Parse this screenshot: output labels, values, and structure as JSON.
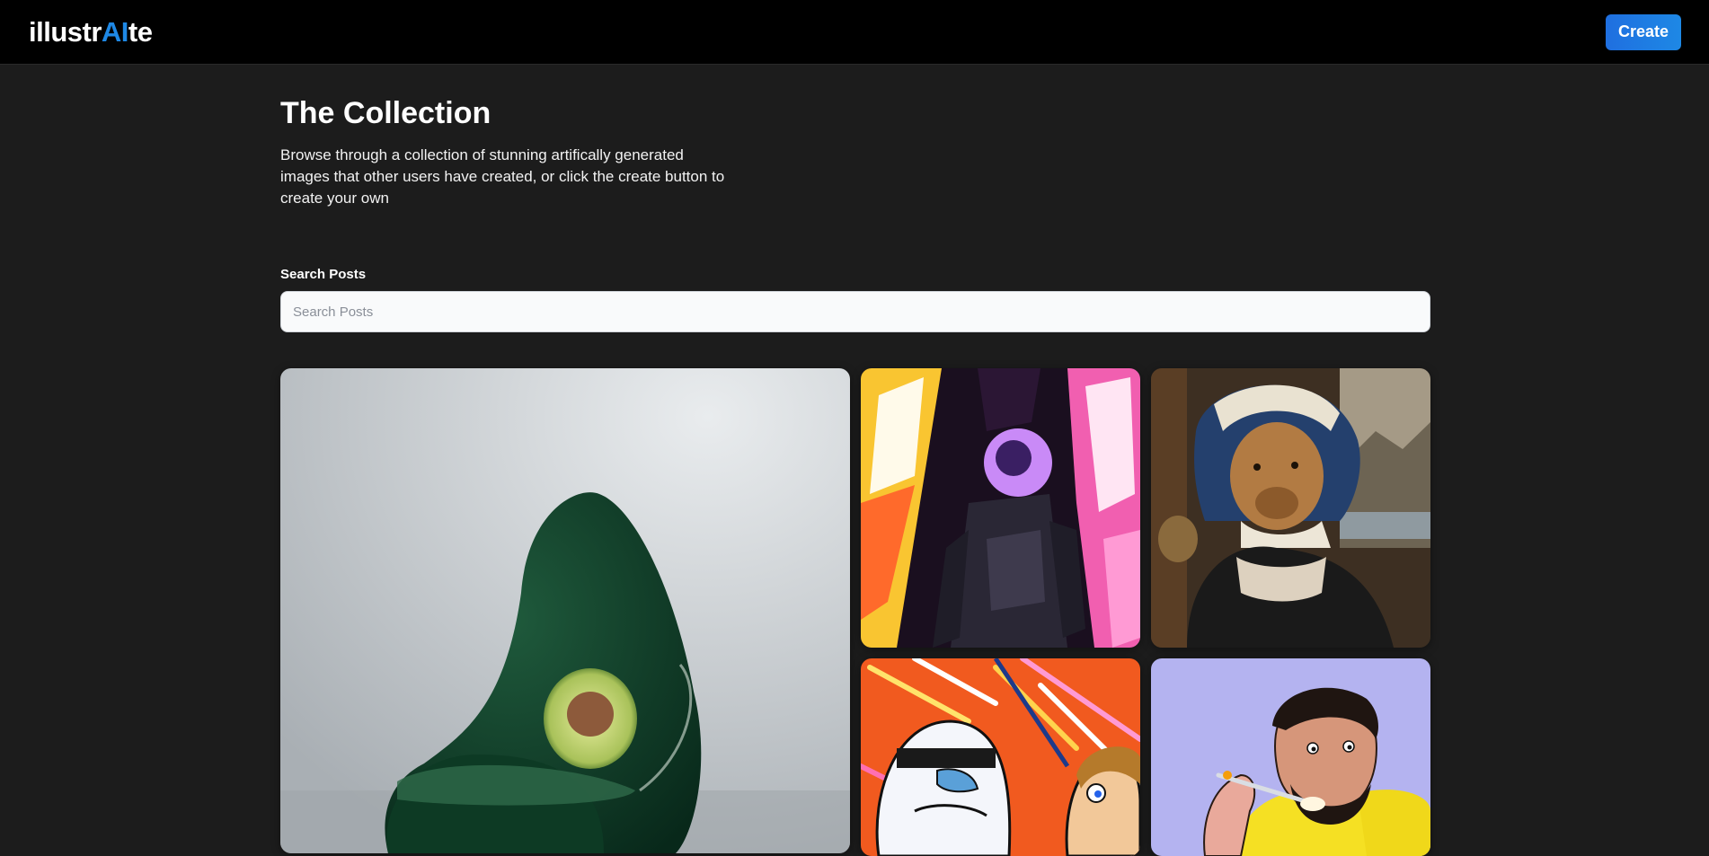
{
  "header": {
    "logo_part1": "illustr",
    "logo_accent": "AI",
    "logo_part2": "te",
    "create_label": "Create"
  },
  "main": {
    "title": "The Collection",
    "description": "Browse through a collection of stunning artifically generated images that other users have created, or click the create button to create your own",
    "search_label": "Search Posts",
    "search_placeholder": "Search Posts"
  },
  "colors": {
    "background": "#1c1c1c",
    "topbar": "#000000",
    "accent": "#1e88e5"
  }
}
